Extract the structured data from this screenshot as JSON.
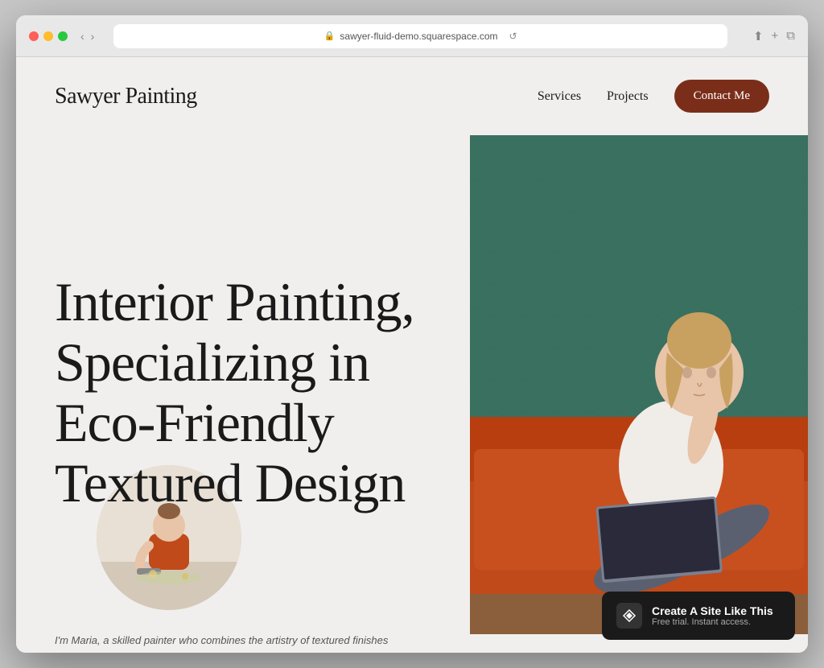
{
  "browser": {
    "url": "sawyer-fluid-demo.squarespace.com",
    "reload_icon": "↺"
  },
  "nav": {
    "logo": "Sawyer Painting",
    "links": [
      {
        "label": "Services",
        "href": "#"
      },
      {
        "label": "Projects",
        "href": "#"
      }
    ],
    "cta": "Contact Me"
  },
  "hero": {
    "headline": "Interior Painting, Specializing in Eco-Friendly Textured Design",
    "bottom_text": "I'm Maria, a skilled painter who combines the artistry of textured finishes"
  },
  "squarespace_promo": {
    "title": "Create A Site Like This",
    "subtitle": "Free trial. Instant access.",
    "icon": "◈"
  },
  "colors": {
    "background": "#f0efed",
    "nav_cta_bg": "#7a2e1a",
    "text_dark": "#1a1a1a",
    "promo_bg": "#1a1a1a"
  }
}
